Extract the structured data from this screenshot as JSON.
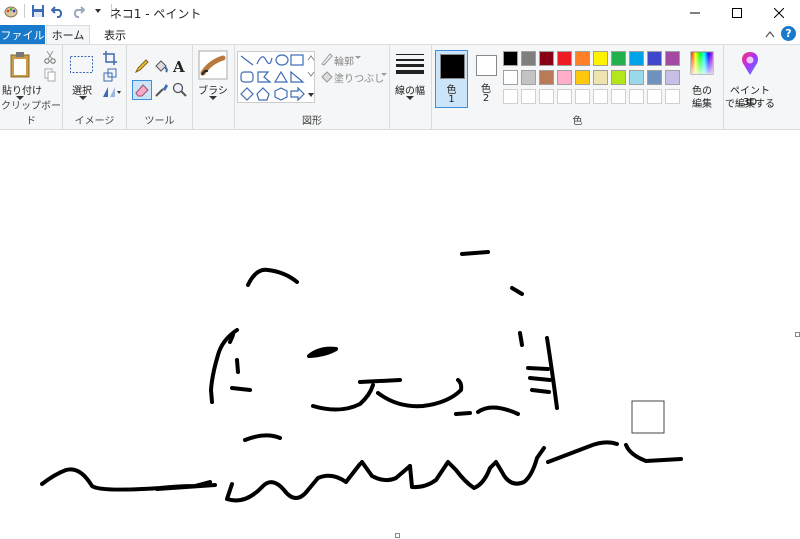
{
  "title": "ネコ1 - ペイント",
  "tabs": {
    "file": "ファイル",
    "home": "ホーム",
    "view": "表示"
  },
  "groups": {
    "clipboard": "クリップボード",
    "image": "イメージ",
    "tools": "ツール",
    "shapes": "図形",
    "colors": "色"
  },
  "buttons": {
    "paste": "貼り付け",
    "select": "選択",
    "brush": "ブラシ",
    "outline": "輪郭",
    "fill": "塗りつぶし",
    "size": "線の幅",
    "color1": "色",
    "color1_num": "1",
    "color2": "色",
    "color2_num": "2",
    "edit_colors_1": "色の",
    "edit_colors_2": "編集",
    "paint3d_1": "ペイント 3D",
    "paint3d_2": "で編集する"
  },
  "colors": {
    "row1": [
      "#000000",
      "#7f7f7f",
      "#880015",
      "#ed1c24",
      "#ff7f27",
      "#fff200",
      "#22b14c",
      "#00a2e8",
      "#3f48cc",
      "#a349a4"
    ],
    "row2": [
      "#ffffff",
      "#c3c3c3",
      "#b97a57",
      "#ffaec9",
      "#ffc90e",
      "#efe4b0",
      "#b5e61d",
      "#99d9ea",
      "#7092be",
      "#c8bfe7"
    ],
    "accent": "#1979ca"
  }
}
